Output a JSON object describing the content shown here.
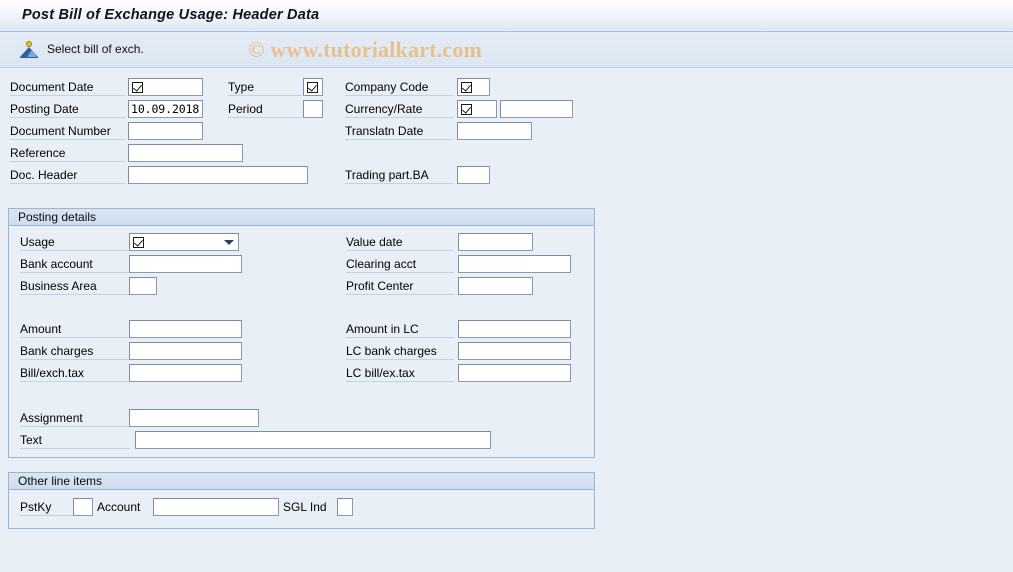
{
  "window": {
    "title": "Post Bill of Exchange Usage: Header Data"
  },
  "toolbar": {
    "select_bill_label": "Select bill of exch.",
    "select_bill_icon": "select-bill-of-exchange-icon"
  },
  "watermark": {
    "text": "© www.tutorialkart.com",
    "color": "#e9c08a"
  },
  "header_fields": {
    "left": [
      {
        "label": "Document Date",
        "value": "",
        "required": true
      },
      {
        "label": "Posting Date",
        "value": "10.09.2018",
        "required": false
      },
      {
        "label": "Document Number",
        "value": "",
        "required": false
      },
      {
        "label": "Reference",
        "value": "",
        "required": false
      },
      {
        "label": "Doc. Header",
        "value": "",
        "required": false
      }
    ],
    "middle": [
      {
        "label": "Type",
        "value": "",
        "required": true
      },
      {
        "label": "Period",
        "value": "",
        "required": false
      }
    ],
    "right": [
      {
        "label": "Company Code",
        "value": "",
        "required": true
      },
      {
        "label": "Currency/Rate",
        "value": "",
        "required": true,
        "rate_value": ""
      },
      {
        "label": "Translatn Date",
        "value": "",
        "required": false
      },
      {
        "label": "Trading part.BA",
        "value": "",
        "required": false
      }
    ]
  },
  "posting_details": {
    "section_title": "Posting details",
    "left": [
      {
        "label": "Usage",
        "value": "",
        "required": true,
        "type": "dropdown"
      },
      {
        "label": "Bank account",
        "value": "",
        "required": false
      },
      {
        "label": "Business Area",
        "value": "",
        "required": false
      }
    ],
    "right": [
      {
        "label": "Value date",
        "value": ""
      },
      {
        "label": "Clearing acct",
        "value": ""
      },
      {
        "label": "Profit Center",
        "value": ""
      }
    ],
    "amounts_left": [
      {
        "label": "Amount",
        "value": ""
      },
      {
        "label": "Bank charges",
        "value": ""
      },
      {
        "label": "Bill/exch.tax",
        "value": ""
      }
    ],
    "amounts_right": [
      {
        "label": "Amount in LC",
        "value": ""
      },
      {
        "label": "LC bank charges",
        "value": ""
      },
      {
        "label": "LC bill/ex.tax",
        "value": ""
      }
    ],
    "assignment": {
      "label": "Assignment",
      "value": ""
    },
    "text": {
      "label": "Text",
      "value": ""
    }
  },
  "other_line_items": {
    "section_title": "Other line items",
    "pstky": {
      "label": "PstKy",
      "value": ""
    },
    "account": {
      "label": "Account",
      "value": ""
    },
    "sgl_ind": {
      "label": "SGL Ind",
      "value": ""
    }
  }
}
